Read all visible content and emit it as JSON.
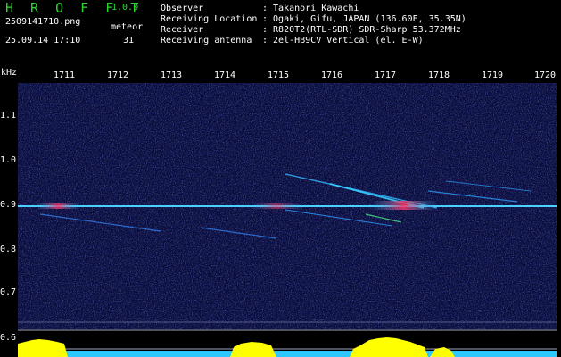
{
  "header": {
    "title": "H R O F F T",
    "version": "1.0.0",
    "file": "2509141710.png",
    "datetime": "25.09.14 17:10",
    "meteor_label": "meteor",
    "meteor_count": "31"
  },
  "info": {
    "observer_key": "Observer",
    "observer_val": ": Takanori Kawachi",
    "location_key": "Receiving Location",
    "location_val": ": Ogaki, Gifu, JAPAN (136.60E, 35.35N)",
    "receiver_key": "Receiver",
    "receiver_val": ": R820T2(RTL-SDR) SDR-Sharp 53.372MHz",
    "antenna_key": "Receiving antenna",
    "antenna_val": ": 2el-HB9CV Vertical (el. E-W)"
  },
  "axes": {
    "y_unit": "kHz",
    "x_ticks": [
      "1711",
      "1712",
      "1713",
      "1714",
      "1715",
      "1716",
      "1717",
      "1718",
      "1719",
      "1720"
    ],
    "y_ticks": [
      "1.1",
      "1.0",
      "0.9",
      "0.8",
      "0.7",
      "0.6"
    ]
  },
  "colors": {
    "background": "#0a0d3a",
    "title_green": "#2bd62b",
    "level_cyan": "#2ec6ff",
    "level_yellow": "#ffff00"
  }
}
